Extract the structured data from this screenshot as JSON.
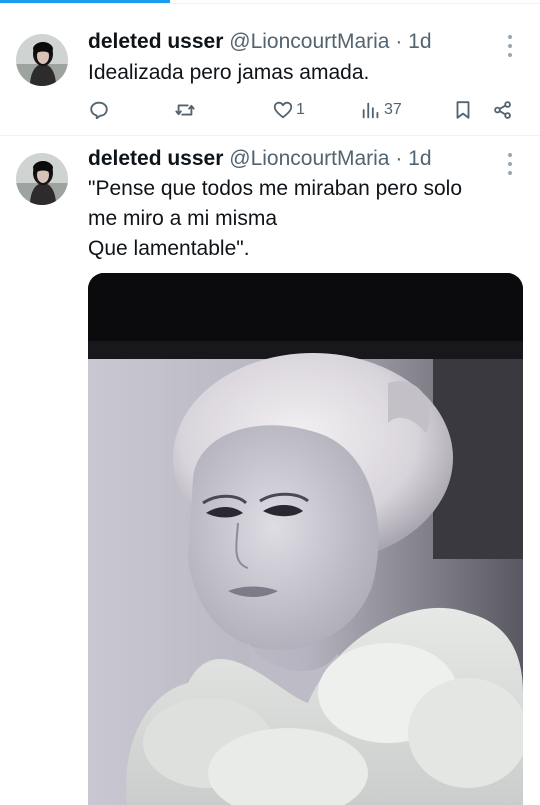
{
  "tweets": [
    {
      "author": {
        "name": "deleted usser",
        "handle": "@LioncourtMaria",
        "separator": "·",
        "time": "1d"
      },
      "text": "Idealizada pero jamas amada.",
      "actions": {
        "replies": "",
        "reposts": "",
        "likes": "1",
        "views": "37"
      },
      "icons": [
        "avatar",
        "more-icon",
        "reply-icon",
        "retweet-icon",
        "heart-icon",
        "views-icon",
        "bookmark-icon",
        "share-icon"
      ]
    },
    {
      "author": {
        "name": "deleted usser",
        "handle": "@LioncourtMaria",
        "separator": "·",
        "time": "1d"
      },
      "text": "\"Pense que todos me miraban pero solo\nme miro a mi misma\nQue lamentable\".",
      "media": {
        "type": "photo",
        "description_icon": "photo-image"
      }
    }
  ],
  "colors": {
    "accent": "#1d9bf0",
    "text_primary": "#0f1419",
    "text_secondary": "#536471",
    "divider": "#eff3f4"
  }
}
